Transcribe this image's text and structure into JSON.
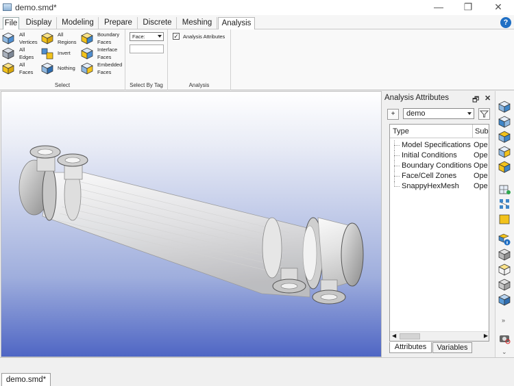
{
  "window": {
    "title": "demo.smd*",
    "minimize": "—",
    "restore": "❐",
    "close": "✕"
  },
  "tabs": [
    {
      "label": "File"
    },
    {
      "label": "Display"
    },
    {
      "label": "Modeling"
    },
    {
      "label": "Prepare"
    },
    {
      "label": "Discrete"
    },
    {
      "label": "Meshing"
    },
    {
      "label": "Analysis"
    }
  ],
  "help": "?",
  "ribbon": {
    "select": {
      "label": "Select",
      "all_vertices": [
        "All",
        "Vertices"
      ],
      "all_edges": [
        "All",
        "Edges"
      ],
      "all_faces": [
        "All",
        "Faces"
      ],
      "all_regions": [
        "All",
        "Regions"
      ],
      "invert": "Invert",
      "nothing": "Nothing",
      "boundary_faces": [
        "Boundary",
        "Faces"
      ],
      "interface_faces": [
        "Interface",
        "Faces"
      ],
      "embedded_faces": [
        "Embedded",
        "Faces"
      ]
    },
    "select_by_tag": {
      "label": "Select By Tag",
      "face_select": "Face:",
      "tag_input": ""
    },
    "analysis": {
      "label": "Analysis",
      "analysis_attributes": "Analysis Attributes",
      "checkbox_mark": "✓"
    }
  },
  "panel": {
    "title": "Analysis Attributes",
    "float_icon": "🗗",
    "close_icon": "✕",
    "add_button": "+",
    "model": "demo",
    "columns": {
      "type": "Type",
      "sub": "Sub"
    },
    "rows": [
      {
        "name": "Model Specifications",
        "value": "Ope"
      },
      {
        "name": "Initial Conditions",
        "value": "Ope"
      },
      {
        "name": "Boundary Conditions",
        "value": "Ope"
      },
      {
        "name": "Face/Cell Zones",
        "value": "Ope"
      },
      {
        "name": "SnappyHexMesh",
        "value": "Ope"
      }
    ],
    "tabs": {
      "attributes": "Attributes",
      "variables": "Variables"
    }
  },
  "document_tab": "demo.smd*",
  "colors": {
    "accent": "#1f6fc4",
    "viewport_bottom": "#4f66c4",
    "cube_yellow": "#f2c21b",
    "cube_blue": "#3f86c8"
  }
}
